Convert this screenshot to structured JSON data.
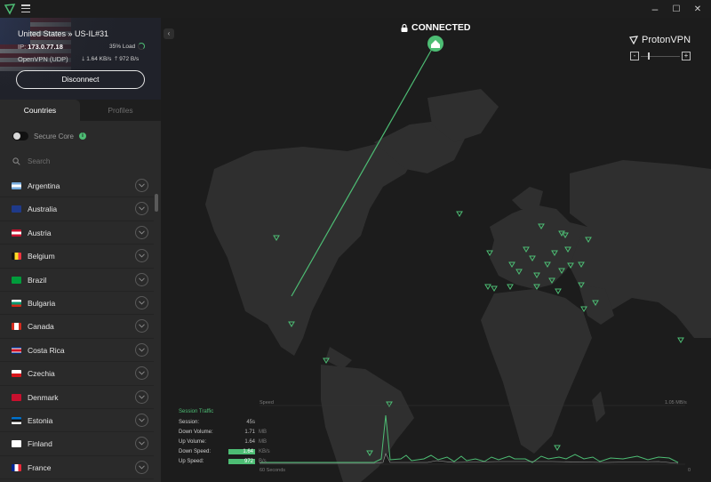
{
  "titlebar": {
    "minimize": "–",
    "maximize": "☐",
    "close": "✕"
  },
  "status": {
    "server": "United States » US-IL#31",
    "ip_label": "IP:",
    "ip_value": "173.0.77.18",
    "load": "35% Load",
    "load_fraction": 0.35,
    "protocol": "OpenVPN (UDP)",
    "download": "1.64 KB/s",
    "upload": "972 B/s",
    "disconnect_label": "Disconnect"
  },
  "tabs": {
    "countries": "Countries",
    "profiles": "Profiles"
  },
  "secure_core": {
    "label": "Secure Core",
    "enabled": false
  },
  "search": {
    "placeholder": "Search",
    "value": ""
  },
  "countries": [
    {
      "name": "Argentina",
      "flag": "f-ar"
    },
    {
      "name": "Australia",
      "flag": "f-au"
    },
    {
      "name": "Austria",
      "flag": "f-at"
    },
    {
      "name": "Belgium",
      "flag": "f-be"
    },
    {
      "name": "Brazil",
      "flag": "f-br"
    },
    {
      "name": "Bulgaria",
      "flag": "f-bg"
    },
    {
      "name": "Canada",
      "flag": "f-ca"
    },
    {
      "name": "Costa Rica",
      "flag": "f-cr"
    },
    {
      "name": "Czechia",
      "flag": "f-cz"
    },
    {
      "name": "Denmark",
      "flag": "f-dk"
    },
    {
      "name": "Estonia",
      "flag": "f-ee"
    },
    {
      "name": "Finland",
      "flag": "f-fi"
    },
    {
      "name": "France",
      "flag": "f-fr"
    }
  ],
  "map": {
    "connection_status": "CONNECTED",
    "brand": "ProtonVPN",
    "zoom_minus": "-",
    "zoom_plus": "+",
    "accent_color": "#4dbd74"
  },
  "traffic": {
    "title": "Session Traffic",
    "rows": [
      {
        "label": "Session:",
        "value": "45s",
        "unit": ""
      },
      {
        "label": "Down Volume:",
        "value": "1.71",
        "unit": "MB"
      },
      {
        "label": "Up Volume:",
        "value": "1.64",
        "unit": "MB"
      },
      {
        "label": "Down Speed:",
        "value": "1.64",
        "unit": "KB/s"
      },
      {
        "label": "Up Speed:",
        "value": "972",
        "unit": "B/s"
      }
    ],
    "graph_title": "Speed",
    "graph_max": "1.05 MB/s",
    "graph_x_start": "60 Seconds",
    "graph_x_end": "0"
  }
}
